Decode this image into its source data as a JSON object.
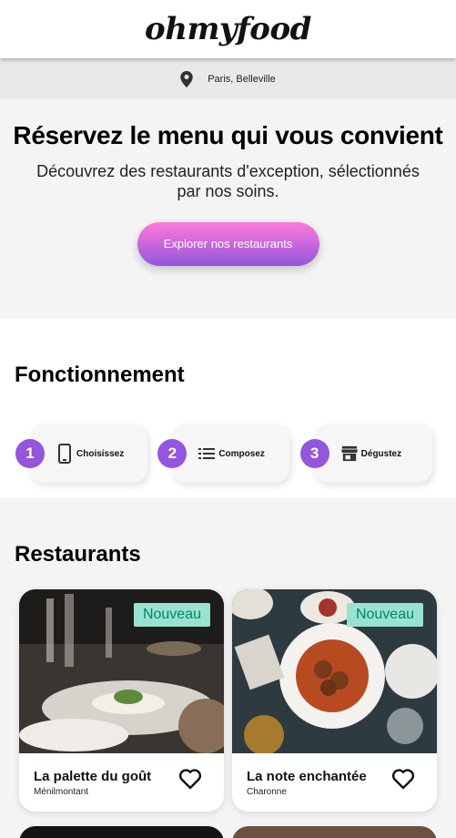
{
  "header": {
    "logo": "ohmyfood"
  },
  "location": {
    "icon": "map-pin-icon",
    "text": "Paris, Belleville"
  },
  "hero": {
    "title": "Réservez le menu qui vous convient",
    "subtitle": "Découvrez des restaurants d'exception, sélectionnés par nos soins.",
    "cta_label": "Explorer nos restaurants"
  },
  "how": {
    "title": "Fonctionnement",
    "steps": [
      {
        "number": "1",
        "icon": "smartphone-icon",
        "label": "Choisissez"
      },
      {
        "number": "2",
        "icon": "list-icon",
        "label": "Composez"
      },
      {
        "number": "3",
        "icon": "store-icon",
        "label": "Dégustez"
      }
    ]
  },
  "restaurants": {
    "title": "Restaurants",
    "items": [
      {
        "name": "La palette du goût",
        "area": "Ménilmontant",
        "badge": "Nouveau"
      },
      {
        "name": "La note enchantée",
        "area": "Charonne",
        "badge": "Nouveau"
      }
    ]
  },
  "colors": {
    "accent": "#9356dc",
    "pink": "#ff79da",
    "badge_bg": "#99e2d0",
    "badge_text": "#008766"
  }
}
